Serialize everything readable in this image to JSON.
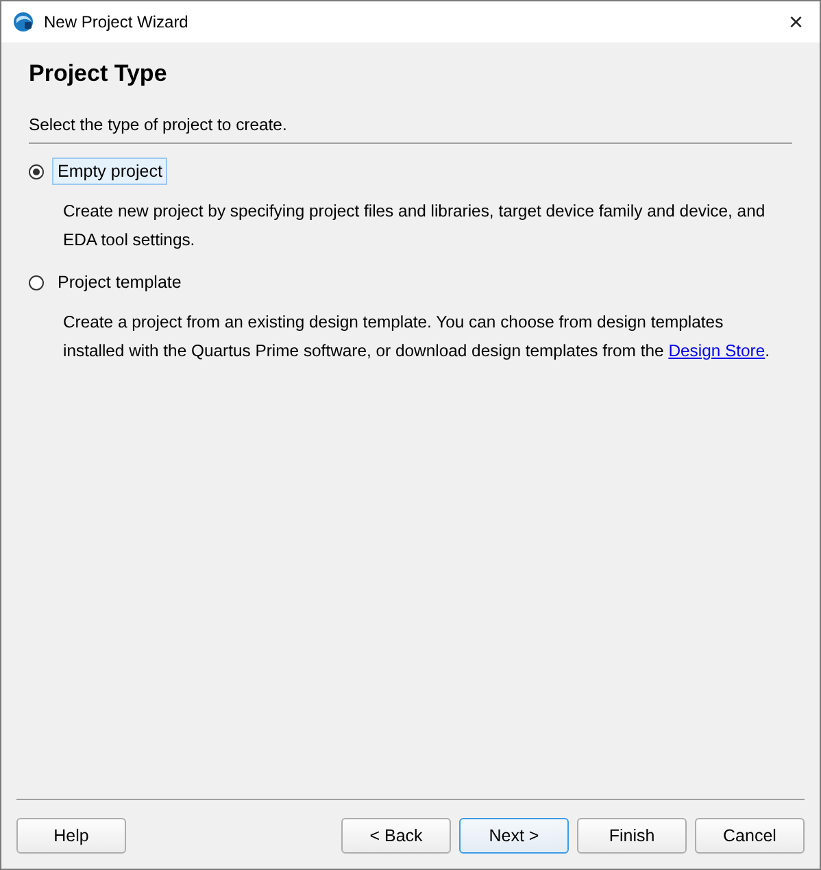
{
  "window": {
    "title": "New Project Wizard",
    "close": "×"
  },
  "page": {
    "heading": "Project Type",
    "instruction": "Select the type of project to create."
  },
  "options": [
    {
      "label": "Empty project",
      "selected": true,
      "description": "Create new project by specifying project files and libraries, target device family and device, and EDA tool settings."
    },
    {
      "label": "Project template",
      "selected": false,
      "description": "Create a project from an existing design template. You can choose from design templates installed with the Quartus Prime software, or download design templates from the ",
      "link": "Design Store",
      "description_end": "."
    }
  ],
  "help_button": {
    "label": "Help",
    "default": false
  },
  "buttons": [
    {
      "label": "< Back",
      "default": false
    },
    {
      "label": "Next >",
      "default": true
    },
    {
      "label": "Finish",
      "default": false
    },
    {
      "label": "Cancel",
      "default": false
    }
  ]
}
